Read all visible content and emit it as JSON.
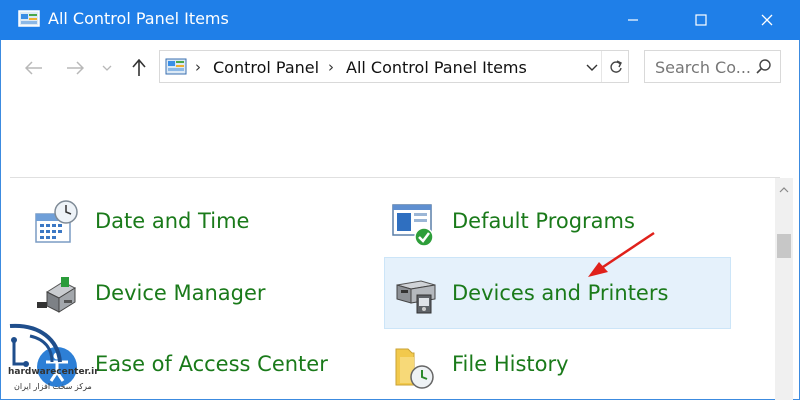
{
  "window": {
    "title": "All Control Panel Items",
    "titlebar_color": "#1f7fe8"
  },
  "address": {
    "crumbs": [
      "Control Panel",
      "All Control Panel Items"
    ],
    "search_placeholder": "Search Co..."
  },
  "items": [
    {
      "label": "Date and Time",
      "icon": "calendar-clock-icon"
    },
    {
      "label": "Default Programs",
      "icon": "default-programs-icon"
    },
    {
      "label": "Device Manager",
      "icon": "device-manager-icon"
    },
    {
      "label": "Devices and Printers",
      "icon": "printer-icon",
      "highlighted": true
    },
    {
      "label": "Ease of Access Center",
      "icon": "ease-of-access-icon"
    },
    {
      "label": "File History",
      "icon": "file-history-icon"
    }
  ],
  "watermark": {
    "site": "hardwarecenter.ir",
    "tagline": "مرکز سخت افزار ایران"
  },
  "colors": {
    "link_green": "#1a7a1a",
    "highlight": "#e5f1fb",
    "annotation_arrow": "#e0211b"
  }
}
